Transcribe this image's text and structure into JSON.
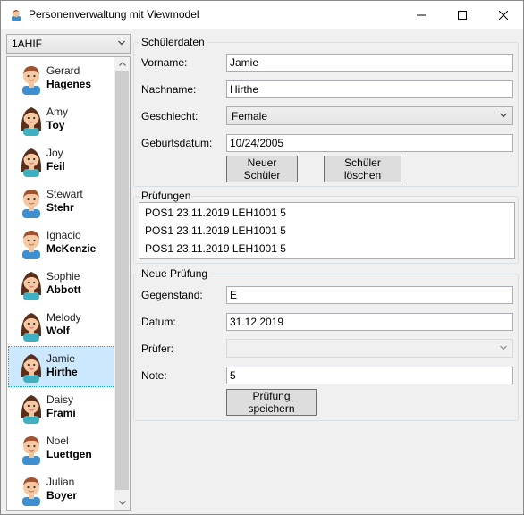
{
  "window": {
    "title": "Personenverwaltung mit Viewmodel"
  },
  "class_select": {
    "value": "1AHIF"
  },
  "students": [
    {
      "first": "Gerard",
      "last": "Hagenes",
      "gender": "male",
      "selected": false
    },
    {
      "first": "Amy",
      "last": "Toy",
      "gender": "female",
      "selected": false
    },
    {
      "first": "Joy",
      "last": "Feil",
      "gender": "female",
      "selected": false
    },
    {
      "first": "Stewart",
      "last": "Stehr",
      "gender": "male",
      "selected": false
    },
    {
      "first": "Ignacio",
      "last": "McKenzie",
      "gender": "male",
      "selected": false
    },
    {
      "first": "Sophie",
      "last": "Abbott",
      "gender": "female",
      "selected": false
    },
    {
      "first": "Melody",
      "last": "Wolf",
      "gender": "female",
      "selected": false
    },
    {
      "first": "Jamie",
      "last": "Hirthe",
      "gender": "female",
      "selected": true
    },
    {
      "first": "Daisy",
      "last": "Frami",
      "gender": "female",
      "selected": false
    },
    {
      "first": "Noel",
      "last": "Luettgen",
      "gender": "male",
      "selected": false
    },
    {
      "first": "Julian",
      "last": "Boyer",
      "gender": "male",
      "selected": false
    }
  ],
  "schuelerdaten": {
    "legend": "Schülerdaten",
    "vorname_label": "Vorname:",
    "vorname_value": "Jamie",
    "nachname_label": "Nachname:",
    "nachname_value": "Hirthe",
    "geschlecht_label": "Geschlecht:",
    "geschlecht_value": "Female",
    "geburtsdatum_label": "Geburtsdatum:",
    "geburtsdatum_value": "10/24/2005",
    "new_button": "Neuer Schüler",
    "delete_button": "Schüler löschen"
  },
  "pruefungen": {
    "legend": "Prüfungen",
    "items": [
      "POS1 23.11.2019 LEH1001 5",
      "POS1 23.11.2019 LEH1001 5",
      "POS1 23.11.2019 LEH1001 5"
    ]
  },
  "neue_pruefung": {
    "legend": "Neue Prüfung",
    "gegenstand_label": "Gegenstand:",
    "gegenstand_value": "E",
    "datum_label": "Datum:",
    "datum_value": "31.12.2019",
    "pruefer_label": "Prüfer:",
    "pruefer_value": "",
    "note_label": "Note:",
    "note_value": "5",
    "save_button": "Prüfung speichern"
  },
  "colors": {
    "selection_bg": "#cce8ff",
    "selection_border": "#26a0da",
    "window_bg": "#f0f0f0",
    "group_border": "#d5dfe5"
  },
  "icons": {
    "app": "person-icon",
    "male_avatar": "male-avatar-icon",
    "female_avatar": "female-avatar-icon"
  }
}
